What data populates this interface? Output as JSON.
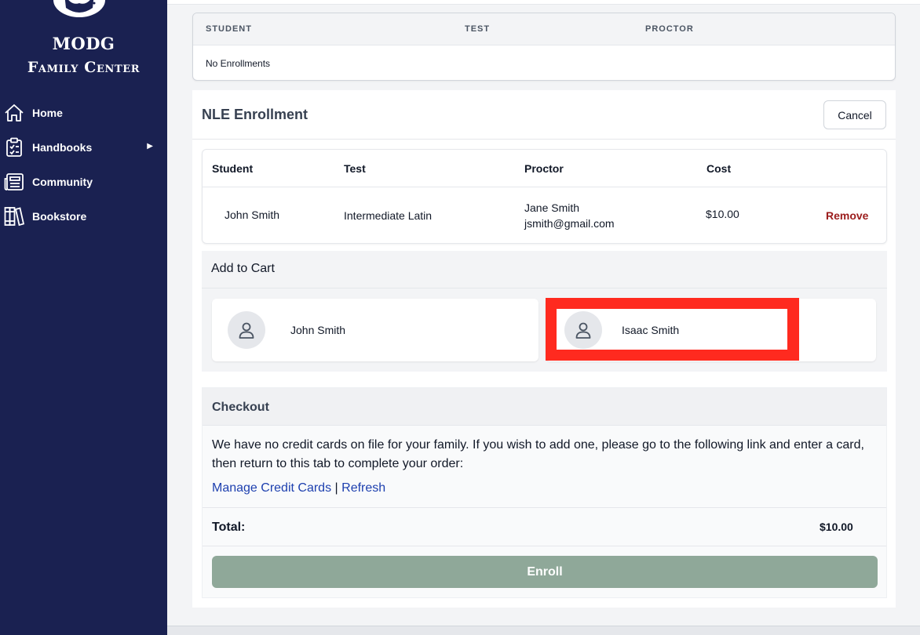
{
  "brand": {
    "line1": "MODG",
    "line2": "Family Center"
  },
  "sidebar": {
    "items": [
      {
        "label": "Home",
        "icon": "home-icon"
      },
      {
        "label": "Handbooks",
        "icon": "clipboard-icon",
        "has_submenu": true
      },
      {
        "label": "Community",
        "icon": "newspaper-icon"
      },
      {
        "label": "Bookstore",
        "icon": "books-icon"
      }
    ]
  },
  "enrollments": {
    "headers": [
      "STUDENT",
      "TEST",
      "PROCTOR"
    ],
    "empty_text": "No Enrollments"
  },
  "nle": {
    "title": "NLE Enrollment",
    "cancel_label": "Cancel",
    "table": {
      "headers": [
        "Student",
        "Test",
        "Proctor",
        "Cost"
      ],
      "rows": [
        {
          "student": "John Smith",
          "test": "Intermediate Latin",
          "proctor_name": "Jane Smith",
          "proctor_email": "jsmith@gmail.com",
          "cost": "$10.00",
          "remove_label": "Remove"
        }
      ]
    },
    "add_to_cart": {
      "title": "Add to Cart",
      "students": [
        "John Smith",
        "Isaac Smith"
      ]
    },
    "checkout": {
      "title": "Checkout",
      "message": "We have no credit cards on file for your family. If you wish to add one, please go to the following link and enter a card, then return to this tab to complete your order:",
      "manage_link": "Manage Credit Cards",
      "separator": "|",
      "refresh_link": "Refresh",
      "total_label": "Total:",
      "total_value": "$10.00",
      "enroll_label": "Enroll"
    }
  },
  "colors": {
    "sidebar_bg": "#1a2151",
    "highlight": "#ff2a1f",
    "enroll_button": "#8fa899",
    "remove_link": "#9b1c1c",
    "link": "#1e40af"
  }
}
